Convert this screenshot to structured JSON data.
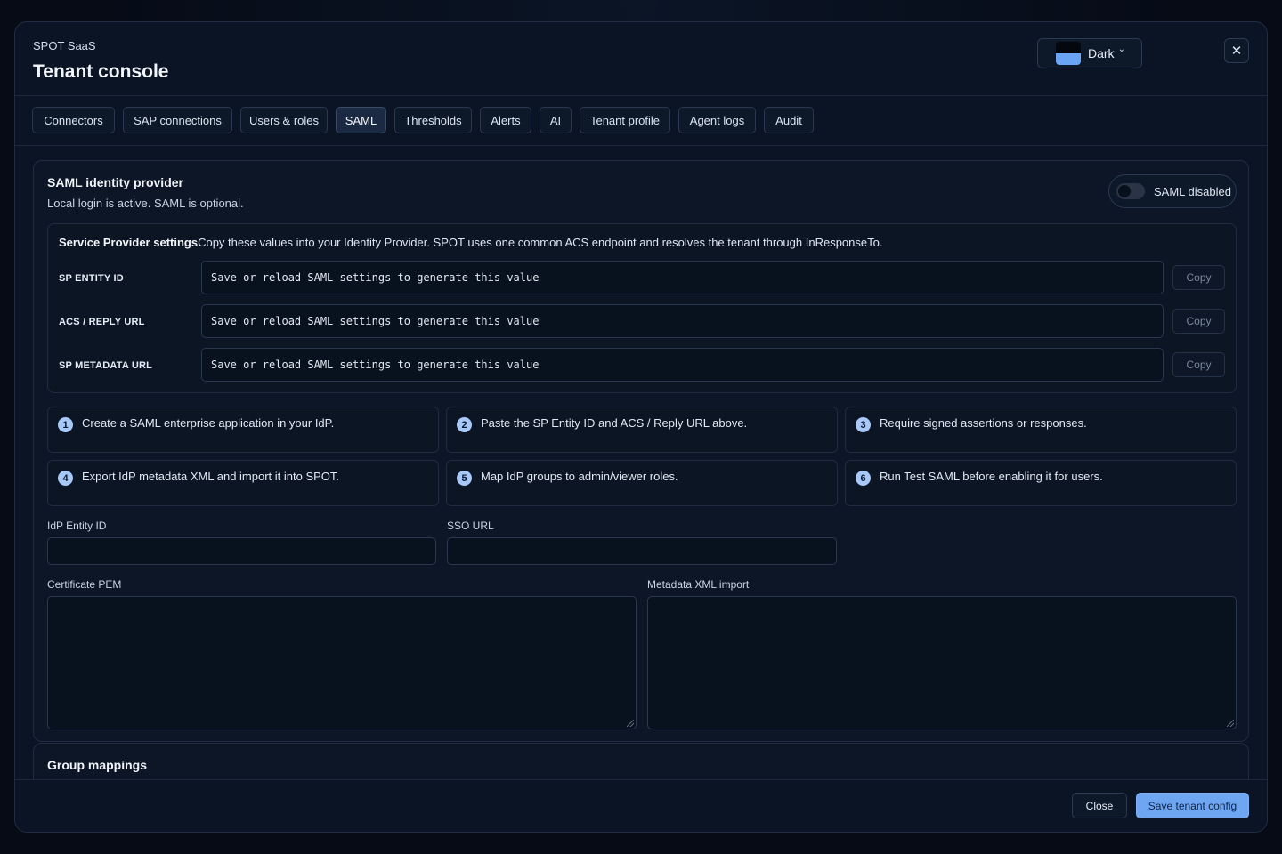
{
  "header": {
    "kicker": "SPOT SaaS",
    "title": "Tenant console",
    "theme": {
      "label": "Dark",
      "swatch_top": "#04070e",
      "swatch_bottom": "#6aa4f4"
    },
    "close_icon": "close-icon"
  },
  "tabs": [
    {
      "label": "Connectors",
      "active": false
    },
    {
      "label": "SAP connections",
      "active": false
    },
    {
      "label": "Users & roles",
      "active": false
    },
    {
      "label": "SAML",
      "active": true
    },
    {
      "label": "Thresholds",
      "active": false
    },
    {
      "label": "Alerts",
      "active": false
    },
    {
      "label": "AI",
      "active": false
    },
    {
      "label": "Tenant profile",
      "active": false
    },
    {
      "label": "Agent logs",
      "active": false
    },
    {
      "label": "Audit",
      "active": false
    }
  ],
  "saml": {
    "title": "SAML identity provider",
    "subtitle": "Local login is active. SAML is optional.",
    "toggle": {
      "label": "SAML disabled",
      "enabled": false
    },
    "sp": {
      "heading": "Service Provider settings",
      "description": "Copy these values into your Identity Provider. SPOT uses one common ACS endpoint and resolves the tenant through InResponseTo.",
      "rows": [
        {
          "label": "SP ENTITY ID",
          "value": "Save or reload SAML settings to generate this value",
          "copy": "Copy"
        },
        {
          "label": "ACS / REPLY URL",
          "value": "Save or reload SAML settings to generate this value",
          "copy": "Copy"
        },
        {
          "label": "SP METADATA URL",
          "value": "Save or reload SAML settings to generate this value",
          "copy": "Copy"
        }
      ]
    },
    "steps": [
      {
        "num": "1",
        "text": "Create a SAML enterprise application in your IdP."
      },
      {
        "num": "2",
        "text": "Paste the SP Entity ID and ACS / Reply URL above."
      },
      {
        "num": "3",
        "text": "Require signed assertions or responses."
      },
      {
        "num": "4",
        "text": "Export IdP metadata XML and import it into SPOT."
      },
      {
        "num": "5",
        "text": "Map IdP groups to admin/viewer roles."
      },
      {
        "num": "6",
        "text": "Run Test SAML before enabling it for users."
      }
    ],
    "fields": {
      "idp_entity_id": {
        "label": "IdP Entity ID",
        "value": ""
      },
      "sso_url": {
        "label": "SSO URL",
        "value": ""
      },
      "certificate_pem": {
        "label": "Certificate PEM",
        "value": ""
      },
      "metadata_xml": {
        "label": "Metadata XML import",
        "value": ""
      }
    }
  },
  "group_mappings": {
    "title": "Group mappings"
  },
  "footer": {
    "close_label": "Close",
    "save_label": "Save tenant config"
  },
  "colors": {
    "accent": "#6fa6f2",
    "background": "#0b1424",
    "step_badge": "#a8c8f7"
  }
}
